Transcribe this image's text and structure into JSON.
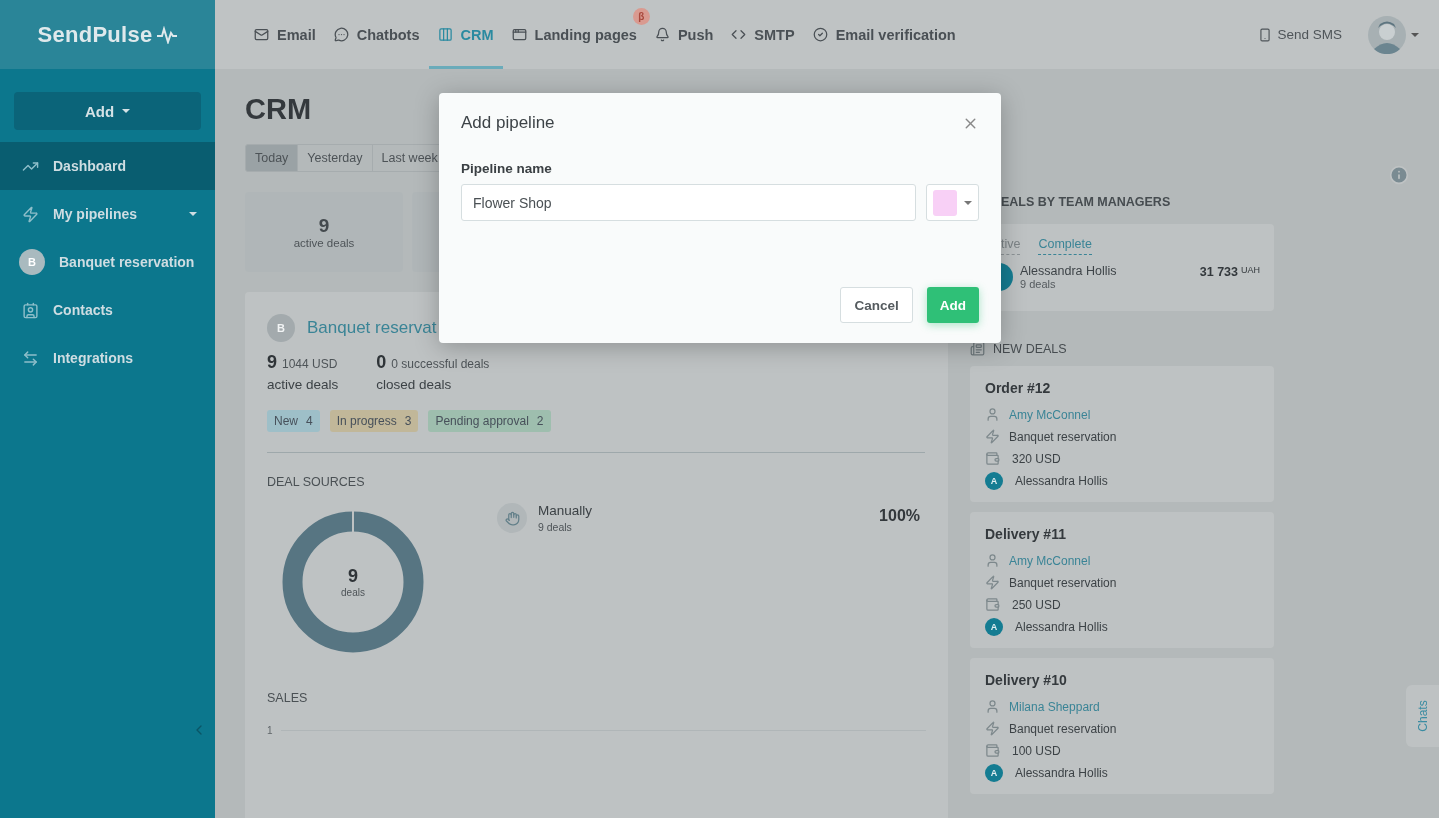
{
  "logo": "SendPulse",
  "nav": [
    {
      "label": "Email",
      "selected": false
    },
    {
      "label": "Chatbots",
      "selected": false
    },
    {
      "label": "CRM",
      "selected": true
    },
    {
      "label": "Landing pages",
      "selected": false,
      "badge": "β"
    },
    {
      "label": "Push",
      "selected": false
    },
    {
      "label": "SMTP",
      "selected": false
    },
    {
      "label": "Email verification",
      "selected": false
    }
  ],
  "send_sms": "Send SMS",
  "sidebar": {
    "add_button": "Add",
    "items": [
      {
        "kind": "link",
        "label": "Dashboard",
        "selected": true
      },
      {
        "kind": "group",
        "label": "My pipelines",
        "selected": false
      },
      {
        "kind": "pipeline",
        "label": "Banquet reservation",
        "avatar": "B",
        "selected": false
      },
      {
        "kind": "link",
        "label": "Contacts",
        "selected": false
      },
      {
        "kind": "link",
        "label": "Integrations",
        "selected": false
      }
    ]
  },
  "page": {
    "title": "CRM",
    "periods": [
      {
        "label": "Today",
        "selected": true
      },
      {
        "label": "Yesterday",
        "selected": false
      },
      {
        "label": "Last week",
        "selected": false
      }
    ],
    "stats": [
      {
        "value": "9",
        "label": "active deals"
      }
    ],
    "pipeline": {
      "avatar": "B",
      "name": "Banquet reservat",
      "active": {
        "count": "9",
        "amount": "1044 USD",
        "label": "active deals"
      },
      "closed": {
        "count": "0",
        "amount": "0 successful deals",
        "label": "closed deals"
      },
      "stages": [
        {
          "label": "New",
          "count": "4",
          "color": "#9ebfc8"
        },
        {
          "label": "In progress",
          "count": "3",
          "color": "#c1b799"
        },
        {
          "label": "Pending approval",
          "count": "2",
          "color": "#9ebeae"
        }
      ]
    },
    "deal_sources": {
      "title": "DEAL SOURCES",
      "total": "9",
      "total_label": "deals",
      "sources": [
        {
          "name": "Manually",
          "deals": "9 deals",
          "share": "100%"
        }
      ]
    },
    "sales": {
      "title": "SALES",
      "yticks": [
        "1"
      ]
    }
  },
  "managers": {
    "title": "EALS BY TEAM MANAGERS",
    "tabs": [
      {
        "label": "tive",
        "selected": false
      },
      {
        "label": "Complete",
        "selected": true
      }
    ],
    "rows": [
      {
        "name": "Alessandra Hollis",
        "deals": "9 deals",
        "amount": "31 733",
        "currency": "UAH"
      }
    ]
  },
  "new_deals": {
    "title": "NEW DEALS",
    "deals": [
      {
        "title": "Order #12",
        "contact": "Amy McConnel",
        "pipeline": "Banquet reservation",
        "amount": "320 USD",
        "manager_initial": "A",
        "manager": "Alessandra Hollis"
      },
      {
        "title": "Delivery #11",
        "contact": "Amy McConnel",
        "pipeline": "Banquet reservation",
        "amount": "250 USD",
        "manager_initial": "A",
        "manager": "Alessandra Hollis"
      },
      {
        "title": "Delivery #10",
        "contact": "Milana Sheppard",
        "pipeline": "Banquet reservation",
        "amount": "100 USD",
        "manager_initial": "A",
        "manager": "Alessandra Hollis"
      }
    ]
  },
  "chats_tab": "Chats",
  "modal": {
    "title": "Add pipeline",
    "label": "Pipeline name",
    "value": "Flower Shop",
    "color": "#f8d0f6",
    "cancel": "Cancel",
    "submit": "Add"
  }
}
